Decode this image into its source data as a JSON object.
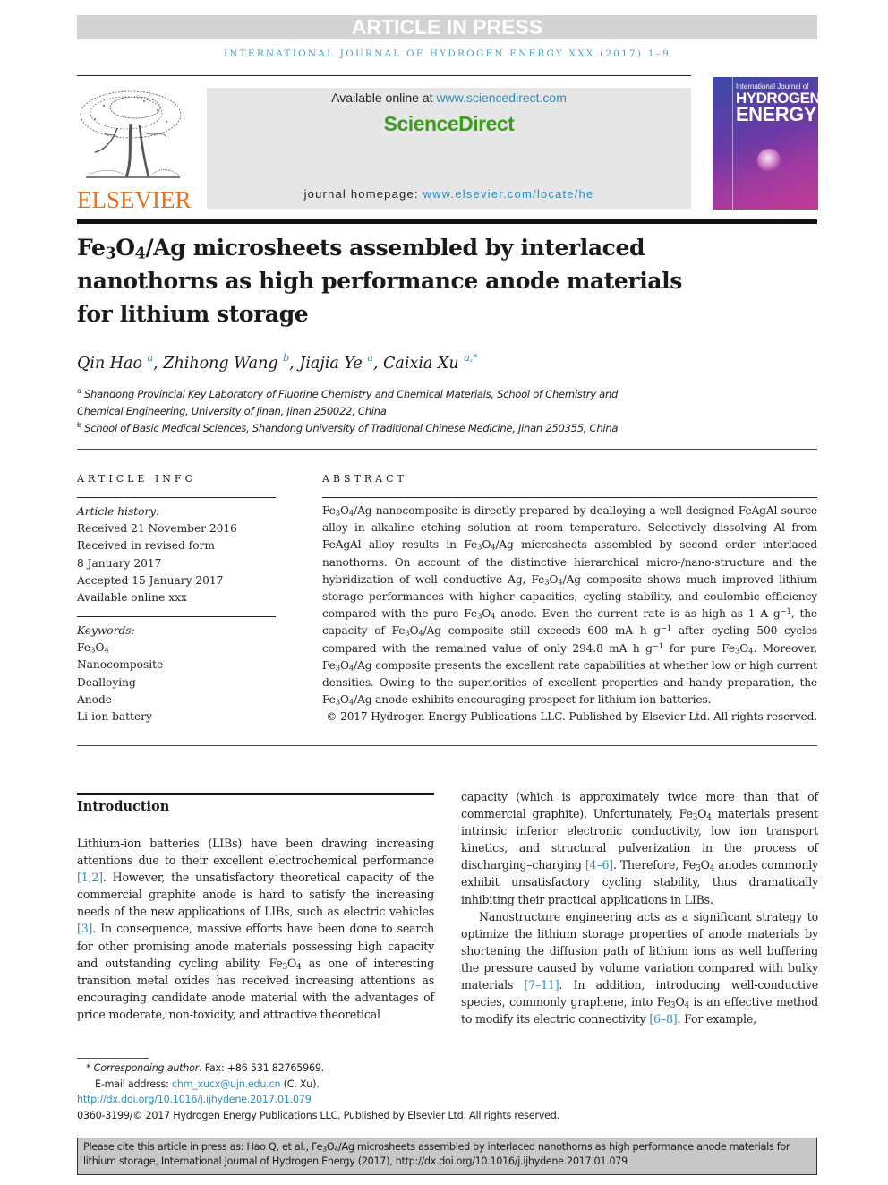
{
  "banner": "ARTICLE IN PRESS",
  "journal_line": "International Journal of Hydrogen Energy xxx (2017) 1–9",
  "header": {
    "publisher_logo_text": "ELSEVIER",
    "available_online_prefix": "Available online at ",
    "available_online_link": "www.sciencedirect.com",
    "sd_title": "ScienceDirect",
    "homepage_prefix": "journal homepage: ",
    "homepage_link": "www.elsevier.com/locate/he",
    "cover": {
      "line1": "International Journal of",
      "line2": "HYDROGEN",
      "line3": "ENERGY"
    }
  },
  "title": {
    "part1": "Fe",
    "sub1": "3",
    "part2": "O",
    "sub2": "4",
    "rest": "/Ag microsheets assembled by interlaced nanothorns as high performance anode materials for lithium storage"
  },
  "authors": [
    {
      "name": "Qin Hao",
      "aff": "a"
    },
    {
      "name": "Zhihong Wang",
      "aff": "b"
    },
    {
      "name": "Jiajia Ye",
      "aff": "a"
    },
    {
      "name": "Caixia Xu",
      "aff": "a,*"
    }
  ],
  "affiliations": [
    {
      "mark": "a",
      "text": "Shandong Provincial Key Laboratory of Fluorine Chemistry and Chemical Materials, School of Chemistry and",
      "text2": "Chemical Engineering, University of Jinan, Jinan 250022, China"
    },
    {
      "mark": "b",
      "text": "School of Basic Medical Sciences, Shandong University of Traditional Chinese Medicine, Jinan 250355, China"
    }
  ],
  "article_info": {
    "heading": "ARTICLE INFO",
    "history_label": "Article history:",
    "history": [
      "Received 21 November 2016",
      "Received in revised form",
      "8 January 2017",
      "Accepted 15 January 2017",
      "Available online xxx"
    ],
    "keywords_label": "Keywords:",
    "keywords": [
      "Nanocomposite",
      "Dealloying",
      "Anode",
      "Li-ion battery"
    ],
    "keyword_formula": {
      "a": "Fe",
      "s1": "3",
      "b": "O",
      "s2": "4"
    }
  },
  "abstract": {
    "heading": "ABSTRACT",
    "segments": {
      "s1": "/Ag nanocomposite is directly prepared by dealloying a well-designed FeAgAl source alloy in alkaline etching solution at room temperature. Selectively dissolving Al from FeAgAl alloy results in ",
      "s2": "/Ag microsheets assembled by second order interlaced nanothorns. On account of the distinctive hierarchical micro-/nano-structure and the hybridization of well conductive Ag, ",
      "s3": "/Ag composite shows much improved lithium storage performances with higher capacities, cycling stability, and coulombic efficiency compared with the pure ",
      "s4": " anode. Even the current rate is as high as 1 A g",
      "s5": ", the capacity of ",
      "s6": "/Ag composite still exceeds 600 mA h g",
      "s7": " after cycling 500 cycles compared with the remained value of only 294.8 mA h g",
      "s8": " for pure ",
      "s9": ". Moreover, ",
      "s10": "/Ag composite presents the excellent rate capabilities at whether low or high current densities. Owing to the superiorities of excellent properties and handy preparation, the ",
      "s11": "/Ag anode exhibits encouraging prospect for lithium ion batteries."
    },
    "fe": "Fe",
    "o": "O",
    "sub3": "3",
    "sub4": "4",
    "exp": "−1",
    "copyright": "© 2017 Hydrogen Energy Publications LLC. Published by Elsevier Ltd. All rights reserved."
  },
  "introduction": {
    "heading": "Introduction",
    "left": {
      "t1": "Lithium-ion batteries (LIBs) have been drawing increasing attentions due to their excellent electrochemical performance ",
      "r1": "[1,2]",
      "t2": ". However, the unsatisfactory theoretical capacity of the commercial graphite anode is hard to satisfy the increasing needs of the new applications of LIBs, such as electric vehicles ",
      "r2": "[3]",
      "t3": ". In consequence, massive efforts have been done to search for other promising anode materials possessing high capacity and outstanding cycling ability. ",
      "t4": " as one of interesting transition metal oxides has received increasing attentions as encouraging candidate anode material with the advantages of price moderate, non-toxicity, and attractive theoretical"
    },
    "right": {
      "p1a": "capacity (which is approximately twice more than that of commercial graphite). Unfortunately, ",
      "p1b": " materials present intrinsic inferior electronic conductivity, low ion transport kinetics, and structural pulverization in the process of discharging–charging ",
      "r1": "[4–6]",
      "p1c": ". Therefore, ",
      "p1d": " anodes commonly exhibit unsatisfactory cycling stability, thus dramatically inhibiting their practical applications in LIBs.",
      "p2a": "Nanostructure engineering acts as a significant strategy to optimize the lithium storage properties of anode materials by shortening the diffusion path of lithium ions as well buffering the pressure caused by volume variation compared with bulky materials ",
      "r2": "[7–11]",
      "p2b": ". In addition, introducing well-conductive species, commonly graphene, into ",
      "p2c": " is an effective method to modify its electric connectivity ",
      "r3": "[6–8]",
      "p2d": ". For example,"
    }
  },
  "footnotes": {
    "corresponding_label": "Corresponding author",
    "corresponding_rest": ". Fax: +86 531 82765969.",
    "email_label": "E-mail address: ",
    "email": "chm_xucx@ujn.edu.cn",
    "email_suffix": " (C. Xu).",
    "doi": "http://dx.doi.org/10.1016/j.ijhydene.2017.01.079",
    "issn_line": "0360-3199/© 2017 Hydrogen Energy Publications LLC. Published by Elsevier Ltd. All rights reserved."
  },
  "cite_box": {
    "t1": "Please cite this article in press as: Hao Q, et al., ",
    "t2": "/Ag microsheets assembled by interlaced nanothorns as high performance anode materials for lithium storage, International Journal of Hydrogen Energy (2017), http://dx.doi.org/10.1016/j.ijhydene.2017.01.079"
  }
}
